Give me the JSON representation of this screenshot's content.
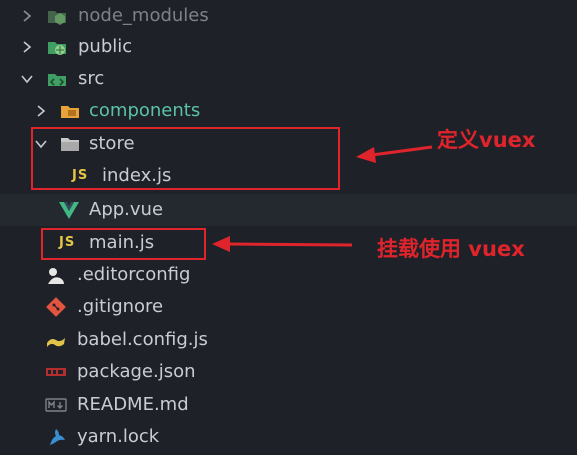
{
  "explorer": {
    "items": [
      {
        "label": "node_modules",
        "icon": "node-folder-icon",
        "type": "folder",
        "state": "collapsed"
      },
      {
        "label": "public",
        "icon": "public-folder-icon",
        "type": "folder",
        "state": "collapsed"
      },
      {
        "label": "src",
        "icon": "src-folder-icon",
        "type": "folder",
        "state": "expanded"
      },
      {
        "label": "components",
        "icon": "components-folder-icon",
        "type": "folder",
        "state": "collapsed"
      },
      {
        "label": "store",
        "icon": "folder-icon",
        "type": "folder",
        "state": "expanded"
      },
      {
        "label": "index.js",
        "icon": "js-file-icon",
        "badge": "JS",
        "type": "file"
      },
      {
        "label": "App.vue",
        "icon": "vue-file-icon",
        "type": "file"
      },
      {
        "label": "main.js",
        "icon": "js-file-icon",
        "badge": "JS",
        "type": "file"
      },
      {
        "label": ".editorconfig",
        "icon": "editorconfig-file-icon",
        "type": "file"
      },
      {
        "label": ".gitignore",
        "icon": "git-file-icon",
        "type": "file"
      },
      {
        "label": "babel.config.js",
        "icon": "babel-file-icon",
        "type": "file"
      },
      {
        "label": "package.json",
        "icon": "npm-file-icon",
        "type": "file"
      },
      {
        "label": "README.md",
        "icon": "markdown-file-icon",
        "type": "file"
      },
      {
        "label": "yarn.lock",
        "icon": "yarn-file-icon",
        "type": "file"
      }
    ]
  },
  "annotations": {
    "store_note": "定义vuex",
    "main_note": "挂载使用 vuex"
  },
  "colors": {
    "background": "#1e2228",
    "selected_row": "#24292f",
    "highlight": "#e0242b",
    "js_badge": "#e5c546",
    "vue_green": "#41b883",
    "folder_green": "#3f9e63",
    "components_orange": "#e8a33b"
  }
}
